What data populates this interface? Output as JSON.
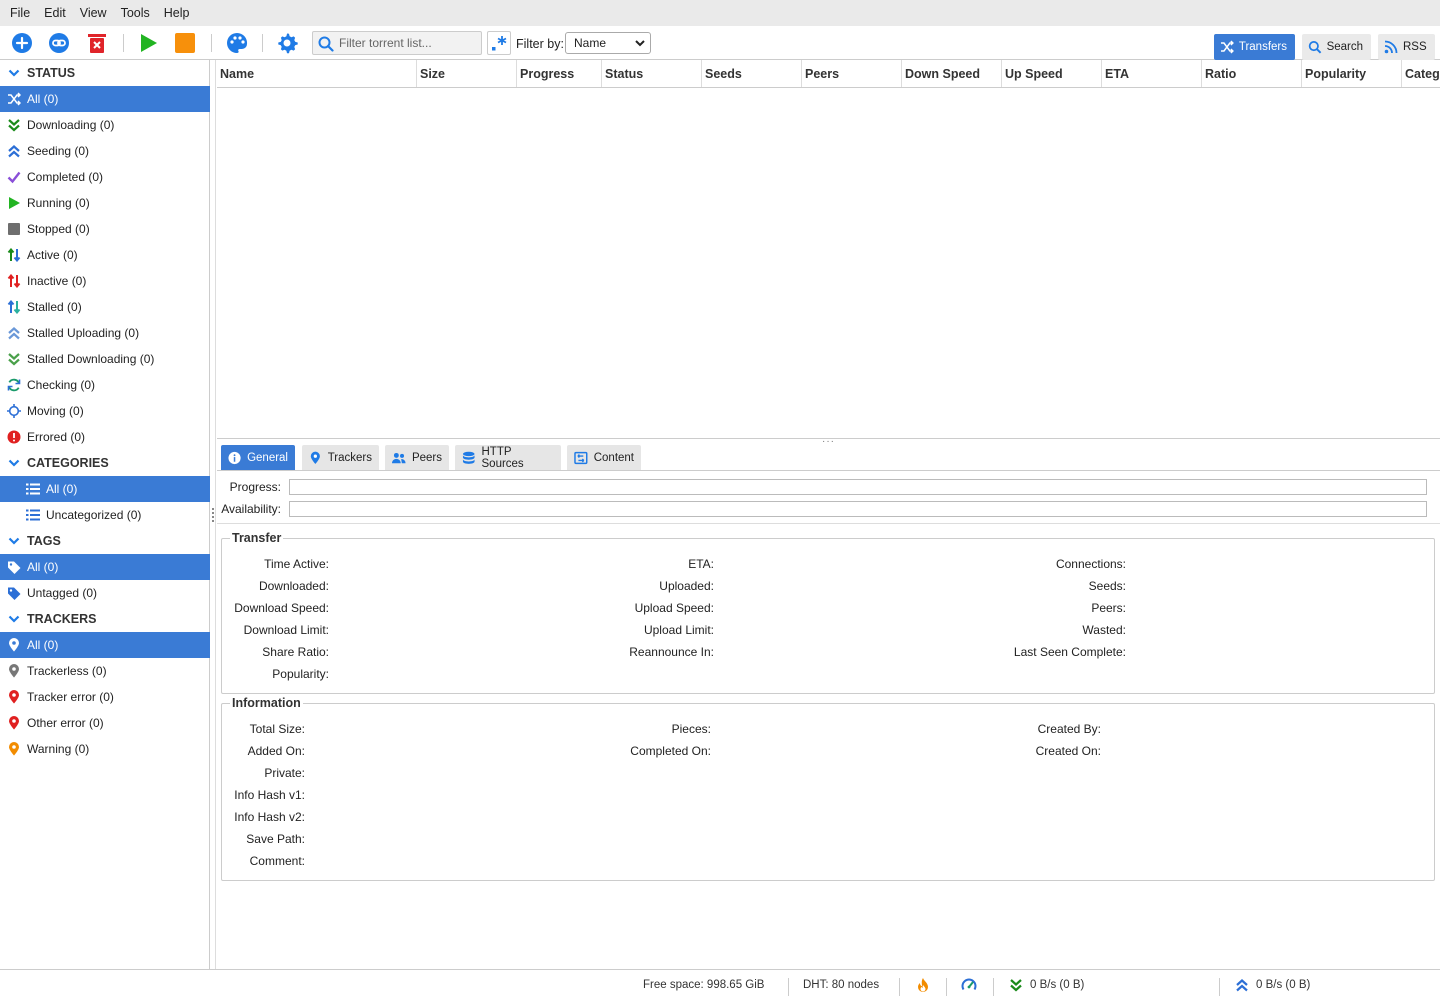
{
  "menu": [
    "File",
    "Edit",
    "View",
    "Tools",
    "Help"
  ],
  "toolbar": {
    "filter_placeholder": "Filter torrent list...",
    "filter_by_label": "Filter by:",
    "filter_by_value": "Name",
    "icons": [
      "add-torrent-icon",
      "add-link-icon",
      "delete-icon",
      "start-icon",
      "stop-icon",
      "theme-palette-icon",
      "settings-icon"
    ]
  },
  "view_tabs": [
    {
      "label": "Transfers",
      "active": true
    },
    {
      "label": "Search",
      "active": false
    },
    {
      "label": "RSS",
      "active": false
    }
  ],
  "sidebar": {
    "status_title": "STATUS",
    "status": [
      {
        "label": "All (0)",
        "icon": "shuffle-icon",
        "selected": true
      },
      {
        "label": "Downloading (0)",
        "icon": "double-chevron-down-icon"
      },
      {
        "label": "Seeding (0)",
        "icon": "double-chevron-up-icon"
      },
      {
        "label": "Completed (0)",
        "icon": "checkmark-icon"
      },
      {
        "label": "Running (0)",
        "icon": "play-icon"
      },
      {
        "label": "Stopped (0)",
        "icon": "stop-square-icon"
      },
      {
        "label": "Active (0)",
        "icon": "arrows-updown-icon"
      },
      {
        "label": "Inactive (0)",
        "icon": "arrows-updown-icon"
      },
      {
        "label": "Stalled (0)",
        "icon": "arrows-updown-icon"
      },
      {
        "label": "Stalled Uploading (0)",
        "icon": "double-chevron-up-icon"
      },
      {
        "label": "Stalled Downloading (0)",
        "icon": "double-chevron-down-icon"
      },
      {
        "label": "Checking (0)",
        "icon": "refresh-icon"
      },
      {
        "label": "Moving (0)",
        "icon": "crosshair-icon"
      },
      {
        "label": "Errored (0)",
        "icon": "error-icon"
      }
    ],
    "categories_title": "CATEGORIES",
    "categories": [
      {
        "label": "All (0)",
        "icon": "list-icon",
        "selected": true
      },
      {
        "label": "Uncategorized (0)",
        "icon": "list-icon"
      }
    ],
    "tags_title": "TAGS",
    "tags": [
      {
        "label": "All (0)",
        "icon": "tag-icon",
        "selected": true
      },
      {
        "label": "Untagged (0)",
        "icon": "tag-icon"
      }
    ],
    "trackers_title": "TRACKERS",
    "trackers": [
      {
        "label": "All (0)",
        "icon": "map-pin-icon",
        "selected": true
      },
      {
        "label": "Trackerless (0)",
        "icon": "map-pin-icon"
      },
      {
        "label": "Tracker error (0)",
        "icon": "map-pin-icon"
      },
      {
        "label": "Other error (0)",
        "icon": "map-pin-icon"
      },
      {
        "label": "Warning (0)",
        "icon": "map-pin-icon"
      }
    ]
  },
  "columns": [
    "Name",
    "Size",
    "Progress",
    "Status",
    "Seeds",
    "Peers",
    "Down Speed",
    "Up Speed",
    "ETA",
    "Ratio",
    "Popularity",
    "Category"
  ],
  "prop_tabs": [
    {
      "label": "General",
      "active": true
    },
    {
      "label": "Trackers"
    },
    {
      "label": "Peers"
    },
    {
      "label": "HTTP Sources"
    },
    {
      "label": "Content"
    }
  ],
  "general": {
    "progress_label": "Progress:",
    "availability_label": "Availability:",
    "progress_value": 0,
    "availability_value": 0,
    "transfer_title": "Transfer",
    "transfer": {
      "col1": [
        "Time Active:",
        "Downloaded:",
        "Download Speed:",
        "Download Limit:",
        "Share Ratio:",
        "Popularity:"
      ],
      "col2": [
        "ETA:",
        "Uploaded:",
        "Upload Speed:",
        "Upload Limit:",
        "Reannounce In:"
      ],
      "col3": [
        "Connections:",
        "Seeds:",
        "Peers:",
        "Wasted:",
        "Last Seen Complete:"
      ]
    },
    "information_title": "Information",
    "information": {
      "col1": [
        "Total Size:",
        "Added On:",
        "Private:",
        "Info Hash v1:",
        "Info Hash v2:",
        "Save Path:",
        "Comment:"
      ],
      "col2": [
        "Pieces:",
        "Completed On:"
      ],
      "col3": [
        "Created By:",
        "Created On:"
      ]
    }
  },
  "statusbar": {
    "free_space": "Free space: 998.65 GiB",
    "dht": "DHT: 80 nodes",
    "download": "0 B/s (0 B)",
    "upload": "0 B/s (0 B)"
  },
  "colors": {
    "accent": "#3a7bd5",
    "download_green": "#1a8a1a",
    "upload_blue": "#2c6fd6",
    "error_red": "#e02020",
    "warning_orange": "#f28c00"
  }
}
